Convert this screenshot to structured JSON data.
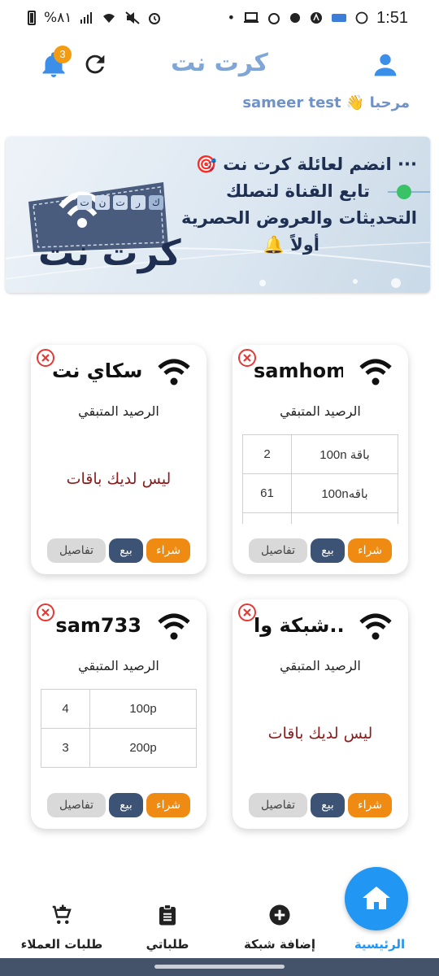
{
  "status_bar": {
    "time": "1:51",
    "battery_text": "%٨١"
  },
  "header": {
    "title": "كرت نت",
    "notification_count": "3"
  },
  "welcome": "مرحبا 👋 sameer test",
  "banner": {
    "line1": "··· انضم لعائلة كرت نت 🎯",
    "line2": "تابع القناة لتصلك",
    "line3": "التحديثات والعروض الحصرية",
    "line4": "أولاً 🔔",
    "logo_text": "كرت نت",
    "logo_chips": [
      "ك",
      "ر",
      "ت",
      "ن",
      "ت"
    ]
  },
  "card_labels": {
    "remaining": "الرصيد المتبقي",
    "no_packages": "ليس لديك باقات",
    "buy": "شراء",
    "sell": "بيع",
    "details": "تفاصيل"
  },
  "cards": [
    {
      "name": "samhome",
      "rows": [
        {
          "package": "باقة 100n",
          "count": "2"
        },
        {
          "package": "باقه100n",
          "count": "61"
        },
        {
          "package": "",
          "count": ""
        }
      ]
    },
    {
      "name": "سكاي نت",
      "rows": []
    },
    {
      "name": "شبكة وا...",
      "rows": []
    },
    {
      "name": "sam733",
      "rows": [
        {
          "package": "100p",
          "count": "4"
        },
        {
          "package": "200p",
          "count": "3"
        }
      ]
    }
  ],
  "bottom_nav": {
    "home": "الرئيسية",
    "add_network": "إضافة شبكة",
    "my_orders": "طلباتي",
    "customer_orders": "طلبات العملاء"
  },
  "colors": {
    "accent_blue": "#2196f3",
    "title_blue": "#7fa6d6",
    "buy_orange": "#ef8a12",
    "sell_navy": "#3c5376",
    "empty_red": "#8b1c1c"
  }
}
